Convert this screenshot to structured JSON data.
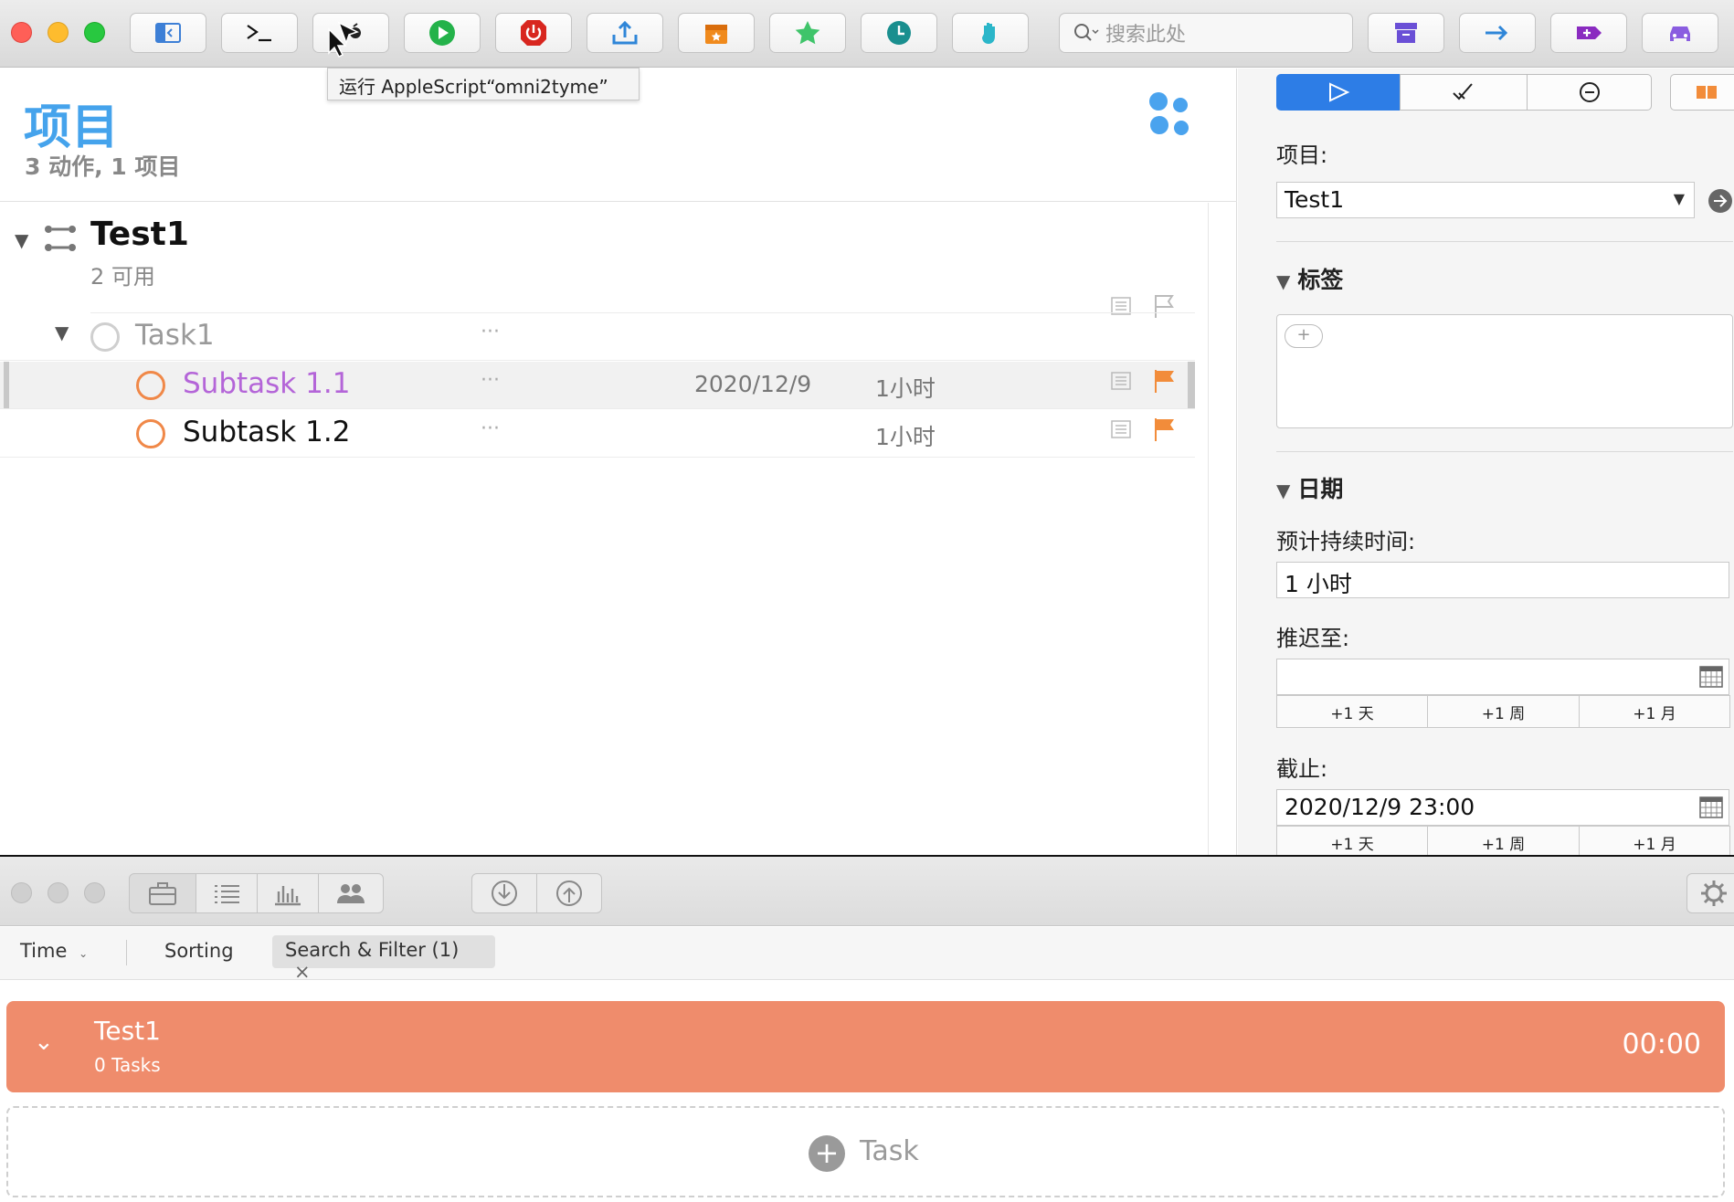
{
  "toolbar": {
    "search_placeholder": "搜索此处",
    "tooltip": "运行 AppleScript“omni2tyme”"
  },
  "main": {
    "title": "项目",
    "subtitle": "3 动作, 1 项目",
    "project": {
      "name": "Test1",
      "status": "2 可用"
    },
    "tasks": [
      {
        "name": "Task1",
        "more": "···"
      },
      {
        "name": "Subtask 1.1",
        "more": "···",
        "due": "2020/12/9",
        "duration": "1小时"
      },
      {
        "name": "Subtask 1.2",
        "more": "···",
        "duration": "1小时"
      }
    ]
  },
  "inspector": {
    "project_label": "项目:",
    "project_value": "Test1",
    "tags_section": "标签",
    "tag_add": "+",
    "dates_section": "日期",
    "duration_label": "预计持续时间:",
    "duration_value": "1 小时",
    "defer_label": "推迟至:",
    "defer_value": "",
    "quick": [
      "+1 天",
      "+1 周",
      "+1 月"
    ],
    "due_label": "截止:",
    "due_value": "2020/12/9 23:00"
  },
  "timer": {
    "filters": {
      "time": "Time",
      "sorting": "Sorting",
      "search": "Search & Filter (1)",
      "close": "×"
    },
    "card": {
      "title": "Test1",
      "sub": "0 Tasks",
      "time": "00:00"
    },
    "add_task": "Task"
  },
  "colors": {
    "accent_blue": "#45a3ec",
    "flag_orange": "#f28c3a",
    "task_purple": "#b465d8",
    "card_salmon": "#ef8c6c"
  }
}
